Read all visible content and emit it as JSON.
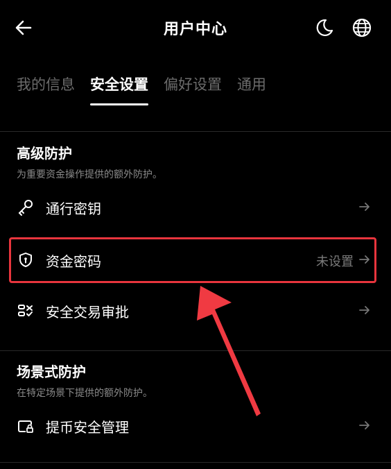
{
  "header": {
    "title": "用户中心",
    "back_icon": "arrow-left-icon",
    "theme_icon": "moon-icon",
    "language_icon": "globe-icon"
  },
  "tabs": [
    {
      "label": "我的信息",
      "active": false
    },
    {
      "label": "安全设置",
      "active": true
    },
    {
      "label": "偏好设置",
      "active": false
    },
    {
      "label": "通用",
      "active": false
    }
  ],
  "sections": [
    {
      "title": "高级防护",
      "description": "为重要资金操作提供的额外防护。",
      "items": [
        {
          "label": "通行密钥",
          "value": "",
          "icon": "key-icon"
        },
        {
          "label": "资金密码",
          "value": "未设置",
          "icon": "shield-icon"
        },
        {
          "label": "安全交易审批",
          "value": "",
          "icon": "transaction-approval-icon"
        }
      ]
    },
    {
      "title": "场景式防护",
      "description": "在特定场景下提供的额外防护。",
      "items": [
        {
          "label": "提币安全管理",
          "value": "",
          "icon": "wallet-lock-icon"
        }
      ]
    }
  ],
  "colors": {
    "background": "#000000",
    "highlight": "#e8353d",
    "muted_text": "#8a8a8a",
    "inactive_tab": "#6b6b6b"
  }
}
